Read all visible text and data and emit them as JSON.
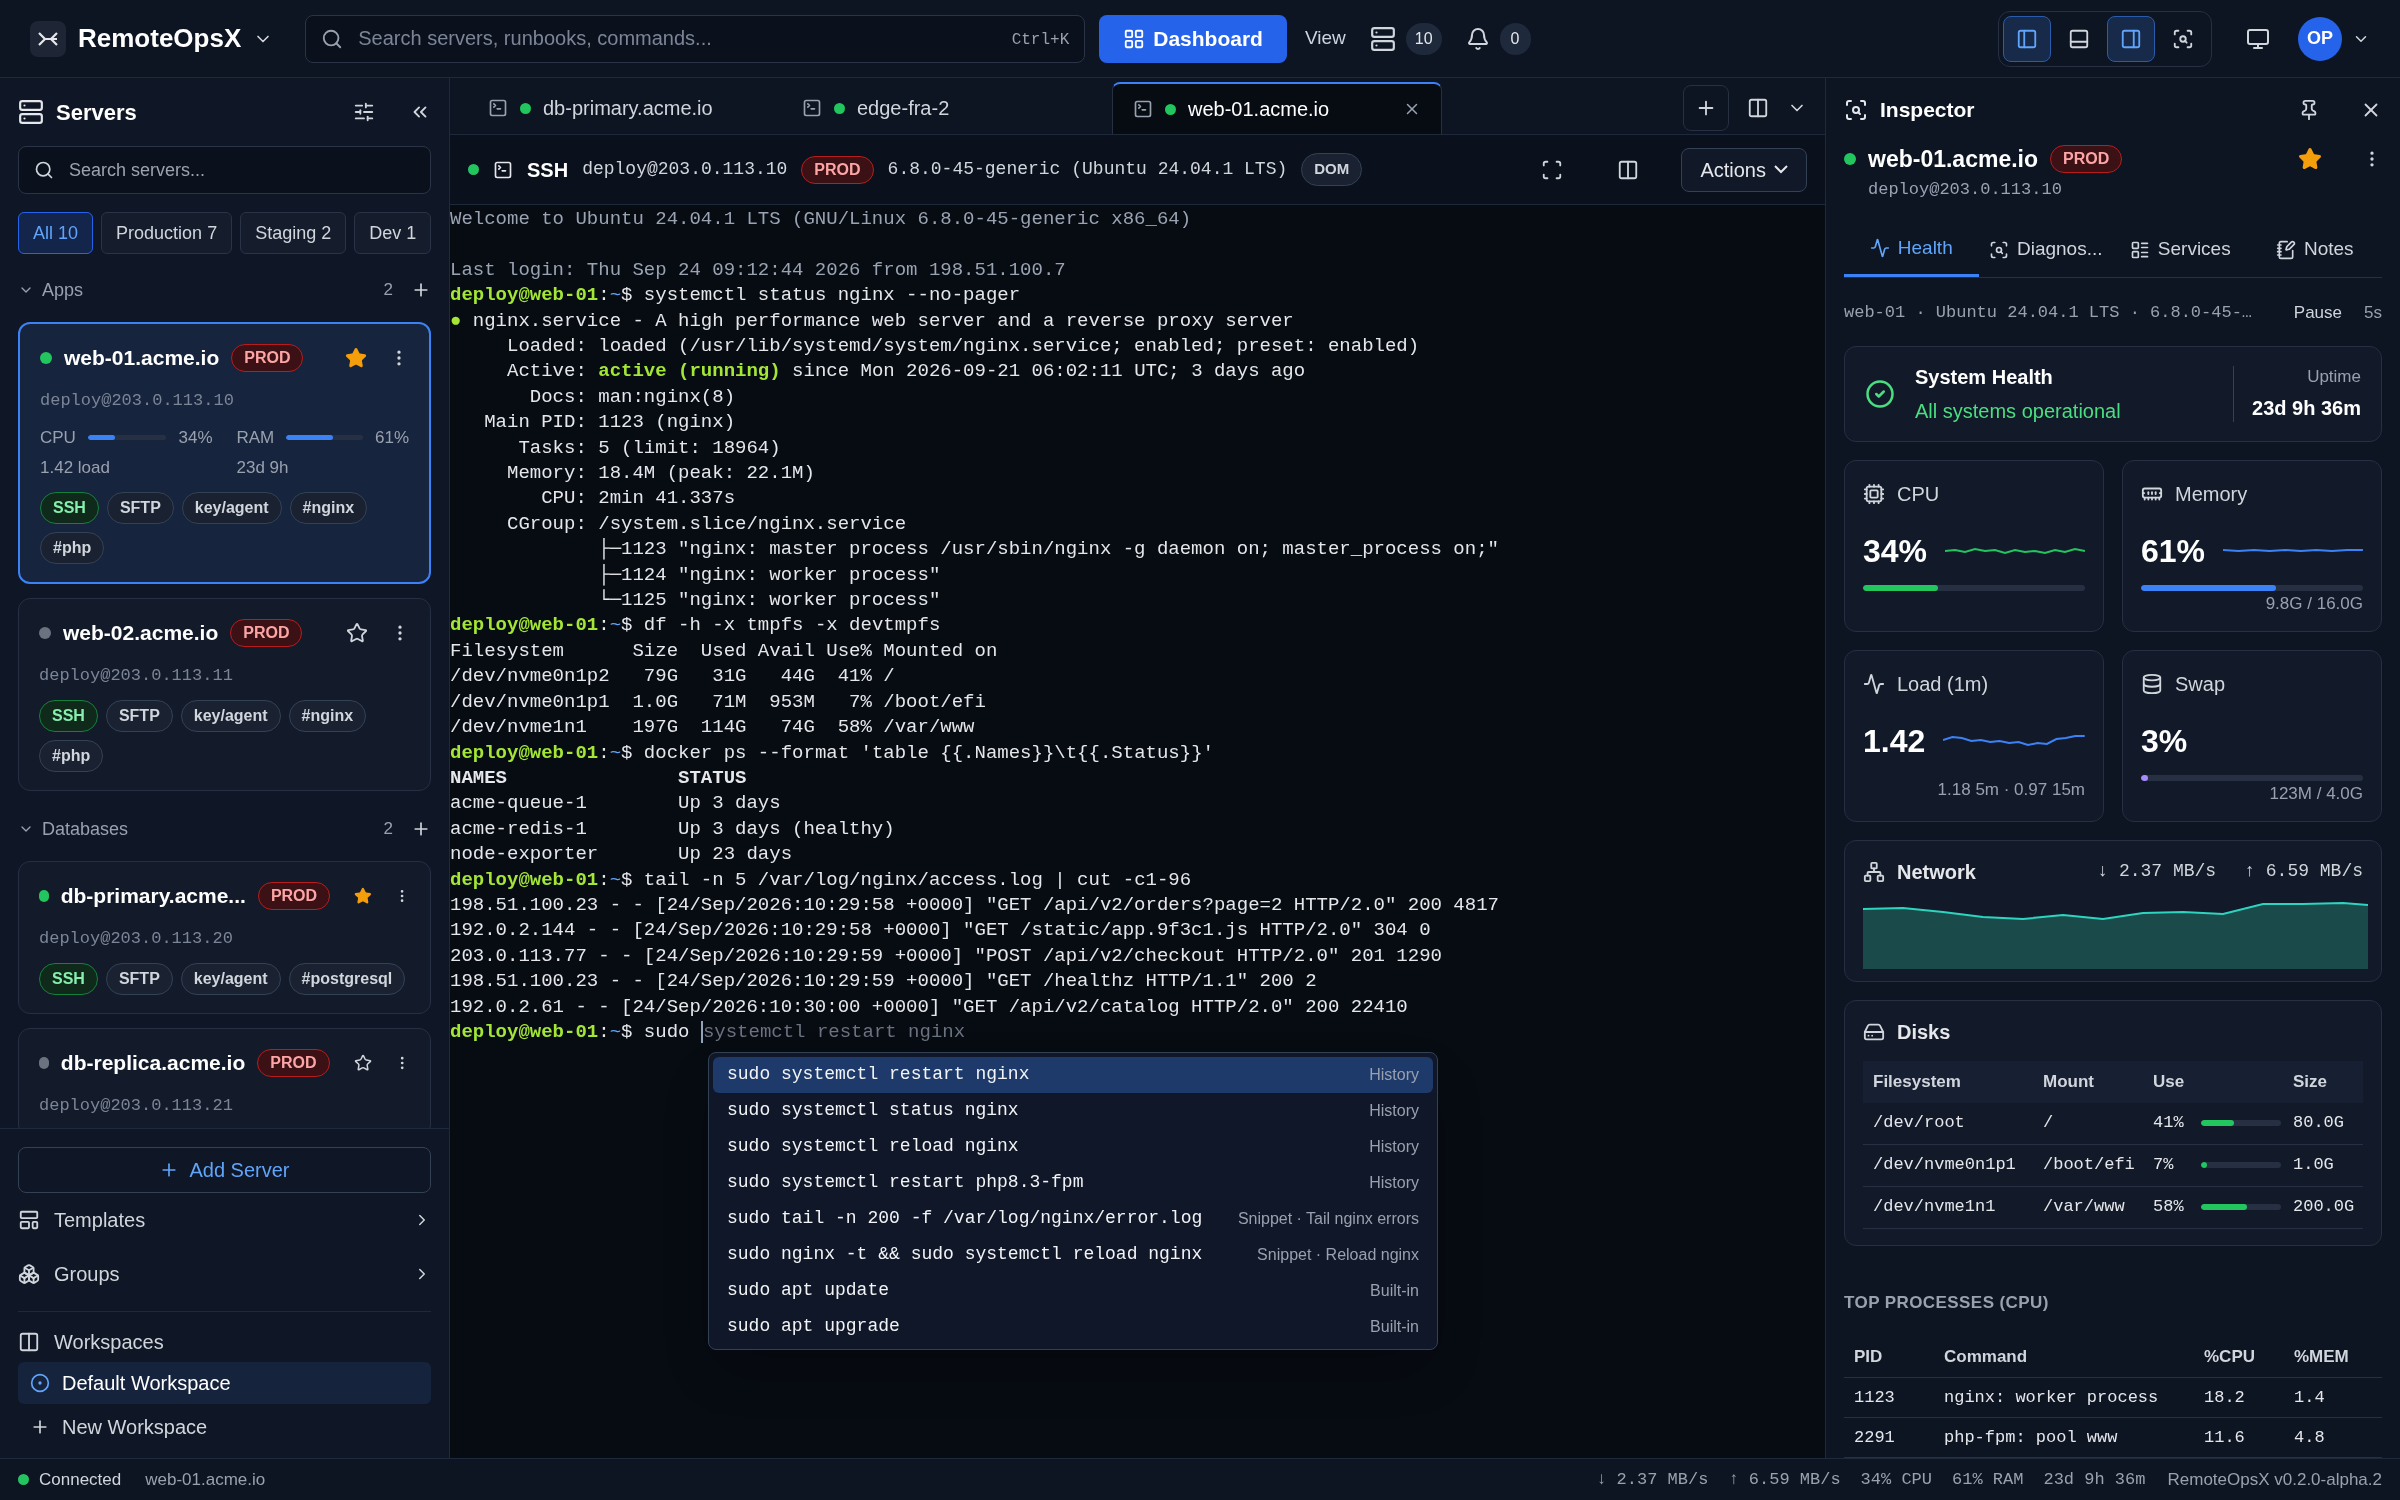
{
  "app": {
    "name": "RemoteOpsX",
    "search_placeholder": "Search servers, runbooks, commands...",
    "shortcut": "Ctrl+K",
    "primary_button": "Dashboard",
    "view_menu": "View",
    "server_count": "10",
    "notification_count": "0",
    "avatar": "OP",
    "layout_toggles": [
      {
        "kind": "left-panel",
        "on": true
      },
      {
        "kind": "bottom-panel",
        "on": false
      },
      {
        "kind": "right-panel",
        "on": true
      },
      {
        "kind": "focus",
        "on": false
      }
    ]
  },
  "sidebar": {
    "title": "Servers",
    "search_placeholder": "Search servers...",
    "filters": [
      {
        "label": "All",
        "count": "10",
        "selected": true
      },
      {
        "label": "Production",
        "count": "7",
        "selected": false
      },
      {
        "label": "Staging",
        "count": "2",
        "selected": false
      },
      {
        "label": "Dev",
        "count": "1",
        "selected": false
      }
    ],
    "groups": [
      {
        "name": "Apps",
        "count": "2",
        "servers": [
          {
            "host": "web-01.acme.io",
            "env": "PROD",
            "color": "#22c55e",
            "starred": true,
            "selected": true,
            "user": "deploy@203.0.113.10",
            "metrics": [
              {
                "label": "CPU",
                "level": 0.34,
                "reading": "34%",
                "note": "1.42 load"
              },
              {
                "label": "RAM",
                "level": 0.61,
                "reading": "61%",
                "note": "23d 9h"
              }
            ],
            "tags": [
              {
                "label": "SSH",
                "active": true
              },
              {
                "label": "SFTP",
                "active": false
              },
              {
                "label": "key/agent",
                "active": false
              },
              {
                "label": "#nginx",
                "active": false
              },
              {
                "label": "#php",
                "active": false
              }
            ]
          },
          {
            "host": "web-02.acme.io",
            "env": "PROD",
            "color": "#6b7280",
            "starred": false,
            "selected": false,
            "user": "deploy@203.0.113.11",
            "tags": [
              {
                "label": "SSH",
                "active": true
              },
              {
                "label": "SFTP",
                "active": false
              },
              {
                "label": "key/agent",
                "active": false
              },
              {
                "label": "#nginx",
                "active": false
              },
              {
                "label": "#php",
                "active": false
              }
            ]
          }
        ]
      },
      {
        "name": "Databases",
        "count": "2",
        "servers": [
          {
            "host": "db-primary.acme...",
            "env": "PROD",
            "color": "#22c55e",
            "starred": true,
            "selected": false,
            "user": "deploy@203.0.113.20",
            "tags": [
              {
                "label": "SSH",
                "active": true
              },
              {
                "label": "SFTP",
                "active": false
              },
              {
                "label": "key/agent",
                "active": false
              },
              {
                "label": "#postgresql",
                "active": false
              }
            ]
          },
          {
            "host": "db-replica.acme.io",
            "env": "PROD",
            "color": "#6b7280",
            "starred": false,
            "selected": false,
            "user": "deploy@203.0.113.21"
          }
        ]
      }
    ],
    "add_button": "Add Server",
    "nav": [
      {
        "kind": "templates",
        "label": "Templates"
      },
      {
        "kind": "groups",
        "label": "Groups"
      }
    ],
    "workspaces_title": "Workspaces",
    "workspaces": [
      {
        "label": "Default Workspace",
        "selected": true
      }
    ],
    "new_workspace": "New Workspace"
  },
  "tabs": [
    {
      "label": "db-primary.acme.io",
      "color": "#22c55e",
      "selected": false
    },
    {
      "label": "edge-fra-2",
      "color": "#22c55e",
      "selected": false
    },
    {
      "label": "web-01.acme.io",
      "color": "#22c55e",
      "selected": true
    }
  ],
  "session": {
    "color": "#22c55e",
    "protocol": "SSH",
    "address": "deploy@203.0.113.10",
    "env": "PROD",
    "kernel": "6.8.0-45-generic (Ubuntu 24.04.1 LTS)",
    "badge": "DOM",
    "actions": "Actions"
  },
  "terminal": {
    "lines": [
      {
        "kind": "text",
        "segments": [
          {
            "kind": "dim",
            "text": "Welcome to Ubuntu 24.04.1 LTS (GNU/Linux 6.8.0-45-generic x86_64)"
          }
        ]
      },
      {
        "kind": "blank"
      },
      {
        "kind": "text",
        "segments": [
          {
            "kind": "dim",
            "text": "Last login: Thu Sep 24 09:12:44 2026 from 198.51.100.7"
          }
        ]
      },
      {
        "kind": "text",
        "segments": [
          {
            "kind": "user",
            "text": "deploy@web-01"
          },
          {
            "kind": "plain",
            "text": ":"
          },
          {
            "kind": "path",
            "text": "~"
          },
          {
            "kind": "plain",
            "text": "$ systemctl status nginx --no-pager"
          }
        ]
      },
      {
        "kind": "text",
        "segments": [
          {
            "kind": "ok",
            "text": "●"
          },
          {
            "kind": "plain",
            "text": " nginx.service - A high performance web server and a reverse proxy server"
          }
        ]
      },
      {
        "kind": "text",
        "segments": [
          {
            "kind": "plain",
            "text": "     Loaded: loaded (/usr/lib/systemd/system/nginx.service; enabled; preset: enabled)"
          }
        ]
      },
      {
        "kind": "text",
        "segments": [
          {
            "kind": "plain",
            "text": "     Active: "
          },
          {
            "kind": "ok",
            "text": "active (running)"
          },
          {
            "kind": "plain",
            "text": " since Mon 2026-09-21 06:02:11 UTC; 3 days ago"
          }
        ]
      },
      {
        "kind": "text",
        "segments": [
          {
            "kind": "plain",
            "text": "       Docs: man:nginx(8)"
          }
        ]
      },
      {
        "kind": "text",
        "segments": [
          {
            "kind": "plain",
            "text": "   Main PID: 1123 (nginx)"
          }
        ]
      },
      {
        "kind": "text",
        "segments": [
          {
            "kind": "plain",
            "text": "      Tasks: 5 (limit: 18964)"
          }
        ]
      },
      {
        "kind": "text",
        "segments": [
          {
            "kind": "plain",
            "text": "     Memory: 18.4M (peak: 22.1M)"
          }
        ]
      },
      {
        "kind": "text",
        "segments": [
          {
            "kind": "plain",
            "text": "        CPU: 2min 41.337s"
          }
        ]
      },
      {
        "kind": "text",
        "segments": [
          {
            "kind": "plain",
            "text": "     CGroup: /system.slice/nginx.service"
          }
        ]
      },
      {
        "kind": "text",
        "segments": [
          {
            "kind": "plain",
            "text": "             ├─1123 \"nginx: master process /usr/sbin/nginx -g daemon on; master_process on;\""
          }
        ]
      },
      {
        "kind": "text",
        "segments": [
          {
            "kind": "plain",
            "text": "             ├─1124 \"nginx: worker process\""
          }
        ]
      },
      {
        "kind": "text",
        "segments": [
          {
            "kind": "plain",
            "text": "             └─1125 \"nginx: worker process\""
          }
        ]
      },
      {
        "kind": "text",
        "segments": [
          {
            "kind": "user",
            "text": "deploy@web-01"
          },
          {
            "kind": "plain",
            "text": ":"
          },
          {
            "kind": "path",
            "text": "~"
          },
          {
            "kind": "plain",
            "text": "$ df -h -x tmpfs -x devtmpfs"
          }
        ]
      },
      {
        "kind": "text",
        "segments": [
          {
            "kind": "plain",
            "text": "Filesystem      Size  Used Avail Use% Mounted on"
          }
        ]
      },
      {
        "kind": "text",
        "segments": [
          {
            "kind": "plain",
            "text": "/dev/nvme0n1p2   79G   31G   44G  41% /"
          }
        ]
      },
      {
        "kind": "text",
        "segments": [
          {
            "kind": "plain",
            "text": "/dev/nvme0n1p1  1.0G   71M  953M   7% /boot/efi"
          }
        ]
      },
      {
        "kind": "text",
        "segments": [
          {
            "kind": "plain",
            "text": "/dev/nvme1n1    197G  114G   74G  58% /var/www"
          }
        ]
      },
      {
        "kind": "text",
        "segments": [
          {
            "kind": "user",
            "text": "deploy@web-01"
          },
          {
            "kind": "plain",
            "text": ":"
          },
          {
            "kind": "path",
            "text": "~"
          },
          {
            "kind": "plain",
            "text": "$ docker ps --format 'table {{.Names}}\\t{{.Status}}'"
          }
        ]
      },
      {
        "kind": "text",
        "segments": [
          {
            "kind": "bold",
            "text": "NAMES               STATUS"
          }
        ]
      },
      {
        "kind": "text",
        "segments": [
          {
            "kind": "plain",
            "text": "acme-queue-1        Up 3 days"
          }
        ]
      },
      {
        "kind": "text",
        "segments": [
          {
            "kind": "plain",
            "text": "acme-redis-1        Up 3 days (healthy)"
          }
        ]
      },
      {
        "kind": "text",
        "segments": [
          {
            "kind": "plain",
            "text": "node-exporter       Up 23 days"
          }
        ]
      },
      {
        "kind": "text",
        "segments": [
          {
            "kind": "user",
            "text": "deploy@web-01"
          },
          {
            "kind": "plain",
            "text": ":"
          },
          {
            "kind": "path",
            "text": "~"
          },
          {
            "kind": "plain",
            "text": "$ tail -n 5 /var/log/nginx/access.log | cut -c1-96"
          }
        ]
      },
      {
        "kind": "text",
        "segments": [
          {
            "kind": "plain",
            "text": "198.51.100.23 - - [24/Sep/2026:10:29:58 +0000] \"GET /api/v2/orders?page=2 HTTP/2.0\" 200 4817"
          }
        ]
      },
      {
        "kind": "text",
        "segments": [
          {
            "kind": "plain",
            "text": "192.0.2.144 - - [24/Sep/2026:10:29:58 +0000] \"GET /static/app.9f3c1.js HTTP/2.0\" 304 0"
          }
        ]
      },
      {
        "kind": "text",
        "segments": [
          {
            "kind": "plain",
            "text": "203.0.113.77 - - [24/Sep/2026:10:29:59 +0000] \"POST /api/v2/checkout HTTP/2.0\" 201 1290"
          }
        ]
      },
      {
        "kind": "text",
        "segments": [
          {
            "kind": "plain",
            "text": "198.51.100.23 - - [24/Sep/2026:10:29:59 +0000] \"GET /healthz HTTP/1.1\" 200 2"
          }
        ]
      },
      {
        "kind": "text",
        "segments": [
          {
            "kind": "plain",
            "text": "192.0.2.61 - - [24/Sep/2026:10:30:00 +0000] \"GET /api/v2/catalog HTTP/2.0\" 200 22410"
          }
        ]
      },
      {
        "kind": "text",
        "segments": [
          {
            "kind": "user",
            "text": "deploy@web-01"
          },
          {
            "kind": "plain",
            "text": ":"
          },
          {
            "kind": "path",
            "text": "~"
          },
          {
            "kind": "plain",
            "text": "$ sudo "
          },
          {
            "kind": "ghost",
            "text": "systemctl restart nginx"
          }
        ]
      }
    ],
    "suggestions": [
      {
        "command": "sudo systemctl restart nginx",
        "source": "History",
        "selected": true
      },
      {
        "command": "sudo systemctl status nginx",
        "source": "History",
        "selected": false
      },
      {
        "command": "sudo systemctl reload nginx",
        "source": "History",
        "selected": false
      },
      {
        "command": "sudo systemctl restart php8.3-fpm",
        "source": "History",
        "selected": false
      },
      {
        "command": "sudo tail -n 200 -f /var/log/nginx/error.log",
        "source": "Snippet · Tail nginx errors",
        "selected": false
      },
      {
        "command": "sudo nginx -t && sudo systemctl reload nginx",
        "source": "Snippet · Reload nginx",
        "selected": false
      },
      {
        "command": "sudo apt update",
        "source": "Built-in",
        "selected": false
      },
      {
        "command": "sudo apt upgrade",
        "source": "Built-in",
        "selected": false
      }
    ]
  },
  "inspector": {
    "title": "Inspector",
    "host": "web-01.acme.io",
    "env": "PROD",
    "color": "#22c55e",
    "user": "deploy@203.0.113.10",
    "starred": true,
    "tabs": [
      {
        "kind": "health",
        "label": "Health",
        "selected": true
      },
      {
        "kind": "diagnostics",
        "label": "Diagnos...",
        "selected": false
      },
      {
        "kind": "services",
        "label": "Services",
        "selected": false
      },
      {
        "kind": "notes",
        "label": "Notes",
        "selected": false
      }
    ],
    "info": "web-01 · Ubuntu 24.04.1 LTS · 6.8.0-45-…",
    "pause": "Pause",
    "interval": "5s",
    "health": {
      "title": "System Health",
      "status": "All systems operational",
      "uptime_label": "Uptime",
      "uptime": "23d 9h 36m"
    },
    "metrics": [
      {
        "kind": "cpu",
        "label": "CPU",
        "value": "34%",
        "level": 0.34,
        "color": "#22c55e"
      },
      {
        "kind": "memory",
        "label": "Memory",
        "value": "61%",
        "level": 0.61,
        "color": "#3b82f6",
        "detail": "9.8G / 16.0G"
      },
      {
        "kind": "load",
        "label": "Load (1m)",
        "value": "1.42",
        "detail": "1.18 5m · 0.97 15m"
      },
      {
        "kind": "swap",
        "label": "Swap",
        "value": "3%",
        "level": 0.03,
        "color": "#a78bfa",
        "detail": "123M / 4.0G"
      }
    ],
    "network": {
      "label": "Network",
      "down": "↓ 2.37 MB/s",
      "up": "↑ 6.59 MB/s"
    },
    "disks": {
      "title": "Disks",
      "columns": [
        "Filesystem",
        "Mount",
        "Use",
        "Size"
      ],
      "rows": [
        {
          "filesystem": "/dev/root",
          "mount": "/",
          "use": "41%",
          "level": 0.41,
          "size": "80.0G"
        },
        {
          "filesystem": "/dev/nvme0n1p1",
          "mount": "/boot/efi",
          "use": "7%",
          "level": 0.07,
          "size": "1.0G"
        },
        {
          "filesystem": "/dev/nvme1n1",
          "mount": "/var/www",
          "use": "58%",
          "level": 0.58,
          "size": "200.0G"
        }
      ]
    },
    "processes": {
      "title": "TOP PROCESSES (CPU)",
      "columns": [
        "PID",
        "Command",
        "%CPU",
        "%MEM"
      ],
      "rows": [
        [
          "1123",
          "nginx: worker process",
          "18.2",
          "1.4"
        ],
        [
          "2291",
          "php-fpm: pool www",
          "11.6",
          "4.8"
        ]
      ]
    }
  },
  "status_bar": {
    "color": "#22c55e",
    "state": "Connected",
    "host": "web-01.acme.io",
    "items": [
      "↓ 2.37 MB/s",
      "↑ 6.59 MB/s",
      "34% CPU",
      "61% RAM",
      "23d 9h 36m"
    ],
    "version": "RemoteOpsX v0.2.0-alpha.2"
  }
}
